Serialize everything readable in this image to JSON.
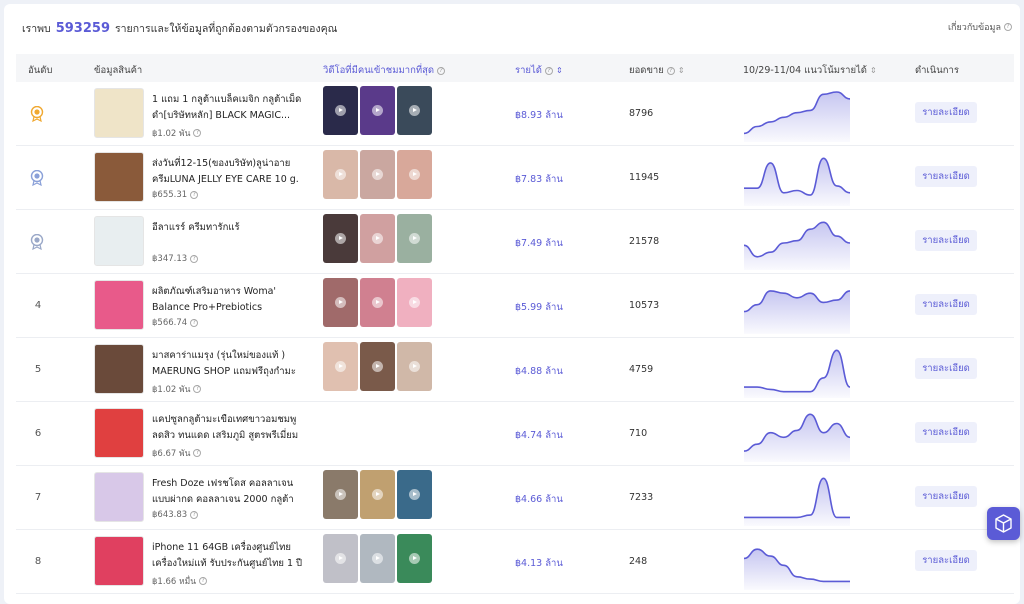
{
  "summary": {
    "prefix": "เราพบ",
    "count": "593259",
    "suffix": "รายการและให้ข้อมูลที่ถูกต้องตามตัวกรองของคุณ",
    "about": "เกี่ยวกับข้อมูล"
  },
  "columns": {
    "rank": "อันดับ",
    "product": "ข้อมูลสินค้า",
    "videos": "วิดีโอที่มีคนเข้าชมมากที่สุด",
    "revenue": "รายได้",
    "sales": "ยอดขาย",
    "trend": "10/29-11/04 แนวโน้มรายได้",
    "action": "ดำเนินการ"
  },
  "detail_label": "รายละเอียด",
  "rows": [
    {
      "rank": "1",
      "medal": "gold",
      "name": "1 แถม 1 กลูต้าแบล็คเมจิก กลูต้าเม็ดดำ[บริษัทหลัก] BLACK MAGIC...",
      "price": "฿1.02 พัน",
      "revenue": "฿8.93 ล้าน",
      "sales": "8796",
      "thumb": "#efe4c8",
      "videos": [
        "#2a2a4a",
        "#5a3a8a",
        "#3a4a5a"
      ],
      "trend": [
        0.1,
        0.25,
        0.35,
        0.45,
        0.55,
        0.6,
        0.95,
        1.0,
        0.85
      ]
    },
    {
      "rank": "2",
      "medal": "silver",
      "name": "ส่งวันที่12-15(ของบริษัท)ลูน่าอาย ครีมLUNA JELLY EYE CARE 10 g. ร้าน...",
      "price": "฿655.31",
      "revenue": "฿7.83 ล้าน",
      "sales": "11945",
      "thumb": "#8a5a3a",
      "videos": [
        "#d9b8a8",
        "#caa7a0",
        "#d8a89a"
      ],
      "trend": [
        0.3,
        0.3,
        0.85,
        0.2,
        0.25,
        0.15,
        0.95,
        0.35,
        0.2
      ]
    },
    {
      "rank": "3",
      "medal": "bronze",
      "name": "อีลาแรร์ ครีมทารักแร้",
      "price": "฿347.13",
      "revenue": "฿7.49 ล้าน",
      "sales": "21578",
      "thumb": "#e8eef0",
      "videos": [
        "#4a3a3a",
        "#d0a0a0",
        "#9ab0a0"
      ],
      "trend": [
        0.45,
        0.2,
        0.3,
        0.5,
        0.55,
        0.8,
        0.95,
        0.65,
        0.5
      ]
    },
    {
      "rank": "4",
      "medal": "",
      "name": "ผลิตภัณฑ์เสริมอาหาร Woma' Balance Pro+Prebiotics ฟรี+โพรไบโอติก ปรับ...",
      "price": "฿566.74",
      "revenue": "฿5.99 ล้าน",
      "sales": "10573",
      "thumb": "#e85a8a",
      "videos": [
        "#a06a6a",
        "#d08090",
        "#f0b0c0"
      ],
      "trend": [
        0.4,
        0.55,
        0.85,
        0.8,
        0.7,
        0.8,
        0.6,
        0.65,
        0.85
      ]
    },
    {
      "rank": "5",
      "medal": "",
      "name": "มาสคาร่าแมรุง (รุ่นใหม่ของแท้ ) MAERUNG SHOP แถมฟรีถุงกำมะหยี่ไ...",
      "price": "฿1.02 พัน",
      "revenue": "฿4.88 ล้าน",
      "sales": "4759",
      "thumb": "#6a4a3a",
      "videos": [
        "#e0c0b0",
        "#7a5a4a",
        "#d0b8a8"
      ],
      "trend": [
        0.15,
        0.15,
        0.1,
        0.05,
        0.05,
        0.05,
        0.35,
        0.95,
        0.15
      ]
    },
    {
      "rank": "6",
      "medal": "",
      "name": "แคปซูลกลูต้ามะเขือเทศขาวอมชมพู ลดสิว ทนแดด เสริมภูมิ สูตรพรีเมี่ยม 30 แคปซู...",
      "price": "฿6.67 พัน",
      "revenue": "฿4.74 ล้าน",
      "sales": "710",
      "thumb": "#e04040",
      "videos": [],
      "trend": [
        0.15,
        0.3,
        0.55,
        0.45,
        0.6,
        0.95,
        0.55,
        0.75,
        0.45
      ]
    },
    {
      "rank": "7",
      "medal": "",
      "name": "Fresh Doze เฟรชโดส คอลลาเจนแบบผ่ากด คอลลาเจน 2000 กลูต้า กลิ่นองุ่นเคี้...",
      "price": "฿643.83",
      "revenue": "฿4.66 ล้าน",
      "sales": "7233",
      "thumb": "#d8c8e8",
      "videos": [
        "#8a7a6a",
        "#c0a070",
        "#3a6a8a"
      ],
      "trend": [
        0.1,
        0.1,
        0.1,
        0.1,
        0.1,
        0.15,
        0.95,
        0.1,
        0.1
      ]
    },
    {
      "rank": "8",
      "medal": "",
      "name": "iPhone 11 64GB เครื่องศูนย์ไทย เครื่องใหม่แท้ รับประกันศูนย์ไทย 1 ปี",
      "price": "฿1.66 หมื่น",
      "revenue": "฿4.13 ล้าน",
      "sales": "248",
      "thumb": "#e04060",
      "videos": [
        "#c0c0c8",
        "#b0b8c0",
        "#3a8a5a"
      ],
      "trend": [
        0.6,
        0.8,
        0.65,
        0.45,
        0.2,
        0.15,
        0.1,
        0.1,
        0.1
      ]
    }
  ],
  "colors": {
    "accent": "#5b5bd6",
    "gold": "#f0a830",
    "silver": "#8aa0d8",
    "bronze": "#9aa8c8"
  }
}
